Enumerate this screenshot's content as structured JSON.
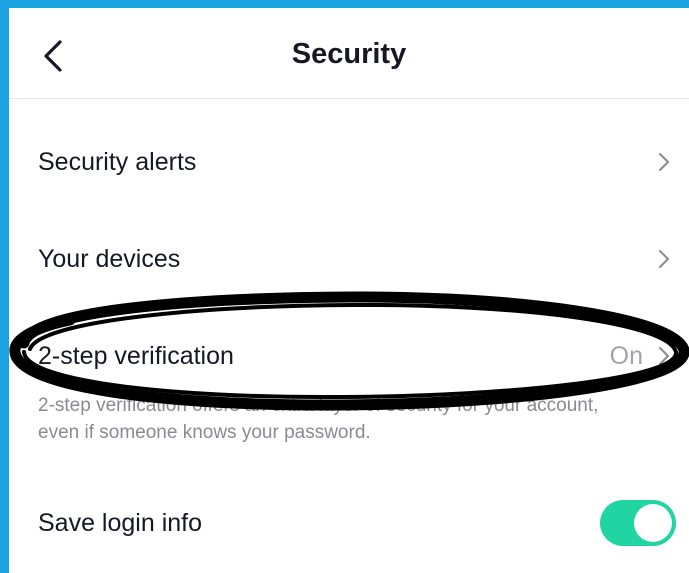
{
  "header": {
    "title": "Security",
    "back_icon": "chevron-left-icon"
  },
  "settings": {
    "items": [
      {
        "label": "Security alerts",
        "icon": "chevron-right-icon"
      },
      {
        "label": "Your devices",
        "icon": "chevron-right-icon"
      },
      {
        "label": "2-step verification",
        "value": "On",
        "icon": "chevron-right-icon",
        "description": "2-step verification offers an extra layer of security for your account, even if someone knows your password."
      },
      {
        "label": "Save login info",
        "toggle_on": true
      }
    ]
  },
  "colors": {
    "background": "#1aa3e0",
    "toggle_on": "#20d5a1",
    "text_primary": "#161823",
    "text_secondary": "#8a8b91",
    "annotation": "#000000"
  },
  "annotation": {
    "shape": "hand-drawn-ellipse",
    "target": "2-step verification"
  }
}
